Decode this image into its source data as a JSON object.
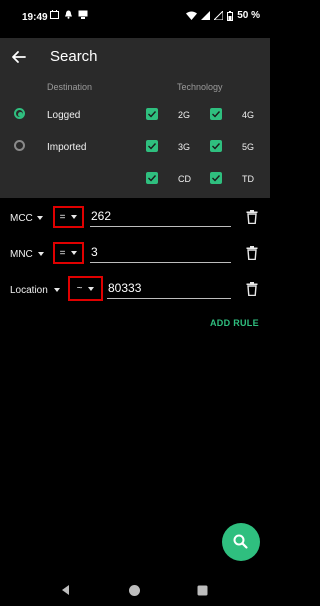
{
  "status": {
    "time": "19:49",
    "battery": "50 %"
  },
  "header": {
    "title": "Search"
  },
  "filters": {
    "destination_heading": "Destination",
    "technology_heading": "Technology",
    "destinations": [
      {
        "label": "Logged",
        "selected": true
      },
      {
        "label": "Imported",
        "selected": false
      }
    ],
    "technologies": [
      {
        "label": "2G",
        "checked": true
      },
      {
        "label": "4G",
        "checked": true
      },
      {
        "label": "3G",
        "checked": true
      },
      {
        "label": "5G",
        "checked": true
      },
      {
        "label": "CD",
        "checked": true
      },
      {
        "label": "TD",
        "checked": true
      }
    ]
  },
  "rules": [
    {
      "field": "MCC",
      "operator": "=",
      "value": "262"
    },
    {
      "field": "MNC",
      "operator": "=",
      "value": "3"
    },
    {
      "field": "Location",
      "operator": "~",
      "value": "80333"
    }
  ],
  "add_rule_label": "ADD RULE",
  "colors": {
    "accent": "#2fbf7f",
    "highlight": "#e00000",
    "panel": "#2a2a2a",
    "background": "#000000"
  },
  "icons": [
    "back-arrow-icon",
    "search-icon",
    "trash-icon",
    "caret-down-icon",
    "wifi-icon",
    "signal-icon",
    "battery-icon"
  ]
}
